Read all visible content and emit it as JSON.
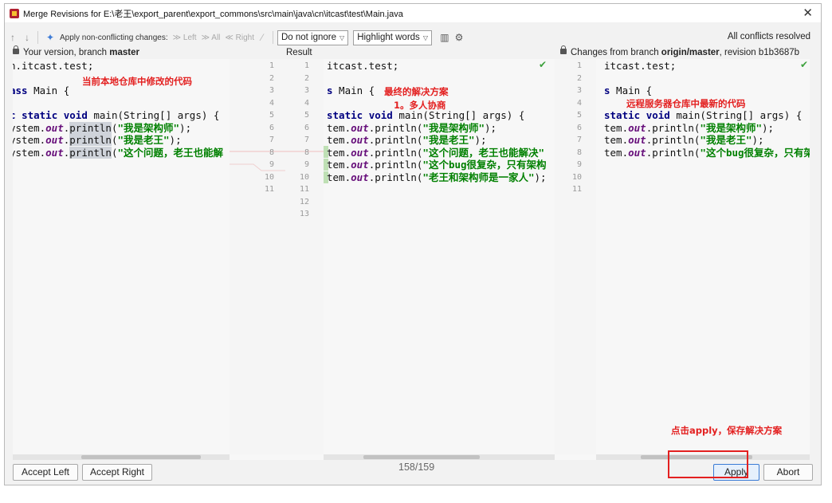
{
  "window": {
    "title": "Merge Revisions for E:\\老王\\export_parent\\export_commons\\src\\main\\java\\cn\\itcast\\test\\Main.java",
    "close_glyph": "✕"
  },
  "toolbar": {
    "apply_nonconflicting_label": "Apply non-conflicting changes:",
    "left_label": "≫ Left",
    "all_label": "≫ All",
    "right_label": "≪ Right",
    "whitespace_select": "Do not ignore",
    "highlight_select": "Highlight words",
    "status": "All conflicts resolved"
  },
  "headers": {
    "left_prefix": "Your version, branch ",
    "left_branch": "master",
    "middle": "Result",
    "right_prefix": "Changes from branch ",
    "right_branch": "origin/master",
    "right_suffix": ", revision b1b3687b"
  },
  "left_code": [
    [
      "",
      "n.itcast.test;"
    ],
    [
      "",
      ""
    ],
    [
      "",
      "ass Main {"
    ],
    [
      "",
      ""
    ],
    [
      "",
      "c static void main(String[] args) {"
    ],
    [
      "",
      "ystem.out.println(\"我是架构师\");"
    ],
    [
      "",
      "ystem.out.println(\"我是老王\");"
    ],
    [
      "",
      "ystem.out.println(\"这个问题，老王也能解"
    ]
  ],
  "left_line_numbers": [
    "1",
    "2",
    "3",
    "4",
    "5",
    "6",
    "7",
    "8",
    "9",
    "10",
    "11"
  ],
  "result_line_numbers": [
    "1",
    "2",
    "3",
    "4",
    "5",
    "6",
    "7",
    "8",
    "9",
    "10",
    "11",
    "12",
    "13"
  ],
  "middle_code": [
    "itcast.test;",
    "",
    "s Main {",
    "",
    "static void main(String[] args) {",
    "tem.out.println(\"我是架构师\");",
    "tem.out.println(\"我是老王\");",
    "tem.out.println(\"这个问题，老王也能解决\"",
    "tem.out.println(\"这个bug很复杂，只有架构",
    "tem.out.println(\"老王和架构师是一家人\");"
  ],
  "right_line_numbers": [
    "1",
    "2",
    "3",
    "4",
    "5",
    "6",
    "7",
    "8",
    "9",
    "10",
    "11"
  ],
  "right_code": [
    "itcast.test;",
    "",
    "s Main {",
    "",
    "static void main(String[] args) {",
    "tem.out.println(\"我是架构师\");",
    "tem.out.println(\"我是老王\");",
    "tem.out.println(\"这个bug很复杂，只有架构"
  ],
  "annotations": {
    "left": "当前本地仓库中修改的代码",
    "middle_1": "最终的解决方案",
    "middle_2": "1。多人协商",
    "right": "远程服务器仓库中最新的代码",
    "apply_hint": "点击apply，保存解决方案"
  },
  "footer": {
    "accept_left": "Accept Left",
    "accept_right": "Accept Right",
    "counter": "158/159",
    "apply": "Apply",
    "abort": "Abort"
  },
  "colors": {
    "annotation": "#e32020",
    "keyword": "#000080",
    "string": "#008000",
    "static_field": "#660e7a",
    "resolved_marker": "#bfe0b5",
    "primary_border": "#3a7bd5"
  }
}
